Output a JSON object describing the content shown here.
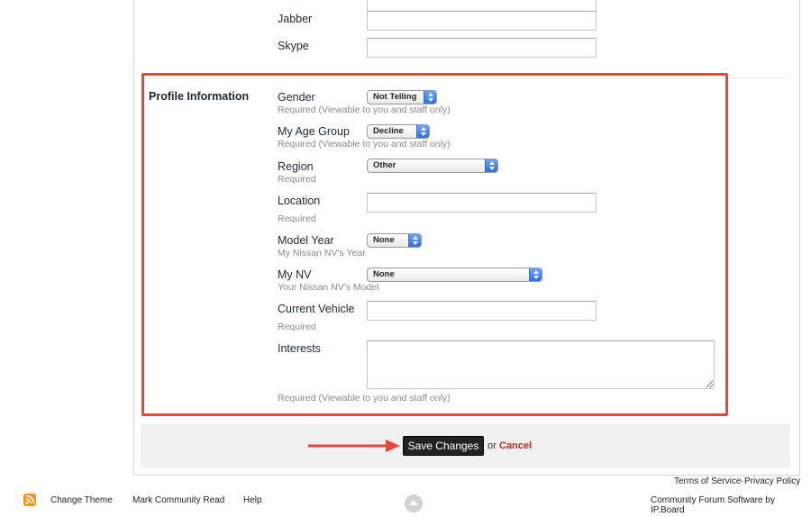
{
  "contact": {
    "jabber_label": "Jabber",
    "skype_label": "Skype"
  },
  "profile": {
    "section_title": "Profile Information",
    "gender": {
      "label": "Gender",
      "value": "Not Telling",
      "desc": "Required (Viewable to you and staff only)"
    },
    "age_group": {
      "label": "My Age Group",
      "value": "Decline",
      "desc": "Required (Viewable to you and staff only)"
    },
    "region": {
      "label": "Region",
      "value": "Other",
      "desc": "Required"
    },
    "location": {
      "label": "Location",
      "desc": "Required"
    },
    "model_year": {
      "label": "Model Year",
      "value": "None",
      "desc": "My Nissan NV's Year"
    },
    "my_nv": {
      "label": "My NV",
      "value": "None",
      "desc": "Your Nissan NV's Model"
    },
    "current_vehicle": {
      "label": "Current Vehicle",
      "desc": "Required"
    },
    "interests": {
      "label": "Interests",
      "desc": "Required (Viewable to you and staff only)"
    }
  },
  "actions": {
    "save_label": "Save Changes",
    "or_text": "or",
    "cancel_label": "Cancel"
  },
  "footer": {
    "terms": "Terms of Service",
    "separator": "·",
    "privacy": "Privacy Policy",
    "change_theme": "Change Theme",
    "mark_read": "Mark Community Read",
    "help": "Help",
    "software": "Community Forum Software by IP.Board"
  },
  "colors": {
    "highlight": "#e8463c",
    "cancel": "#c0291b",
    "rss": "#f7941d"
  },
  "icons": {
    "rss": "rss-icon",
    "back_to_top": "back-to-top-icon",
    "arrow": "red-arrow-annotation"
  }
}
